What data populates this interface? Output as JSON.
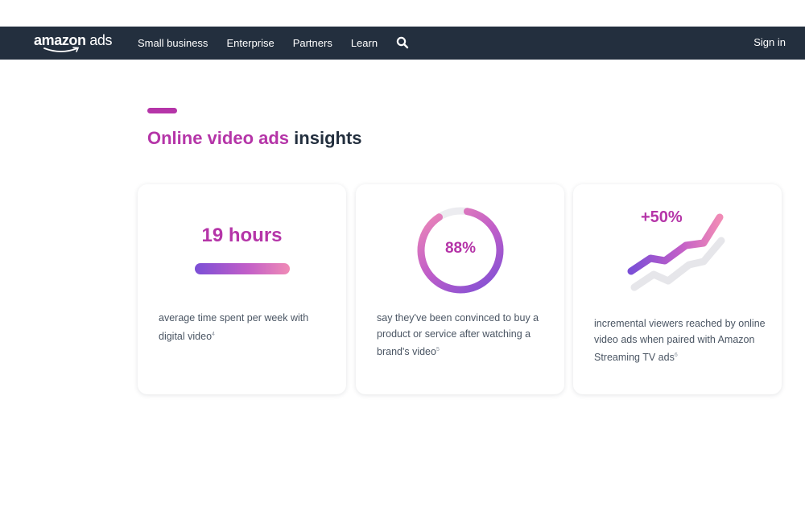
{
  "navbar": {
    "logo_word": "amazon",
    "logo_suffix": "ads",
    "links": [
      "Small business",
      "Enterprise",
      "Partners",
      "Learn"
    ],
    "search_icon": "search-icon",
    "sign_in": "Sign in",
    "background_color": "#232f3e"
  },
  "section": {
    "title_accent": "Online video ads",
    "title_rest": "insights",
    "accent_color": "#b535a8"
  },
  "cards": [
    {
      "stat": "19 hours",
      "text": "average time spent per week with digital video",
      "footnote": "4"
    },
    {
      "stat": "88%",
      "percent": 88,
      "text": "say they've been convinced to buy a product or service after watching a brand's video",
      "footnote": "5"
    },
    {
      "stat": "+50%",
      "text": "incremental viewers reached by online video ads when paired with Amazon Streaming TV ads",
      "footnote": "6"
    }
  ]
}
